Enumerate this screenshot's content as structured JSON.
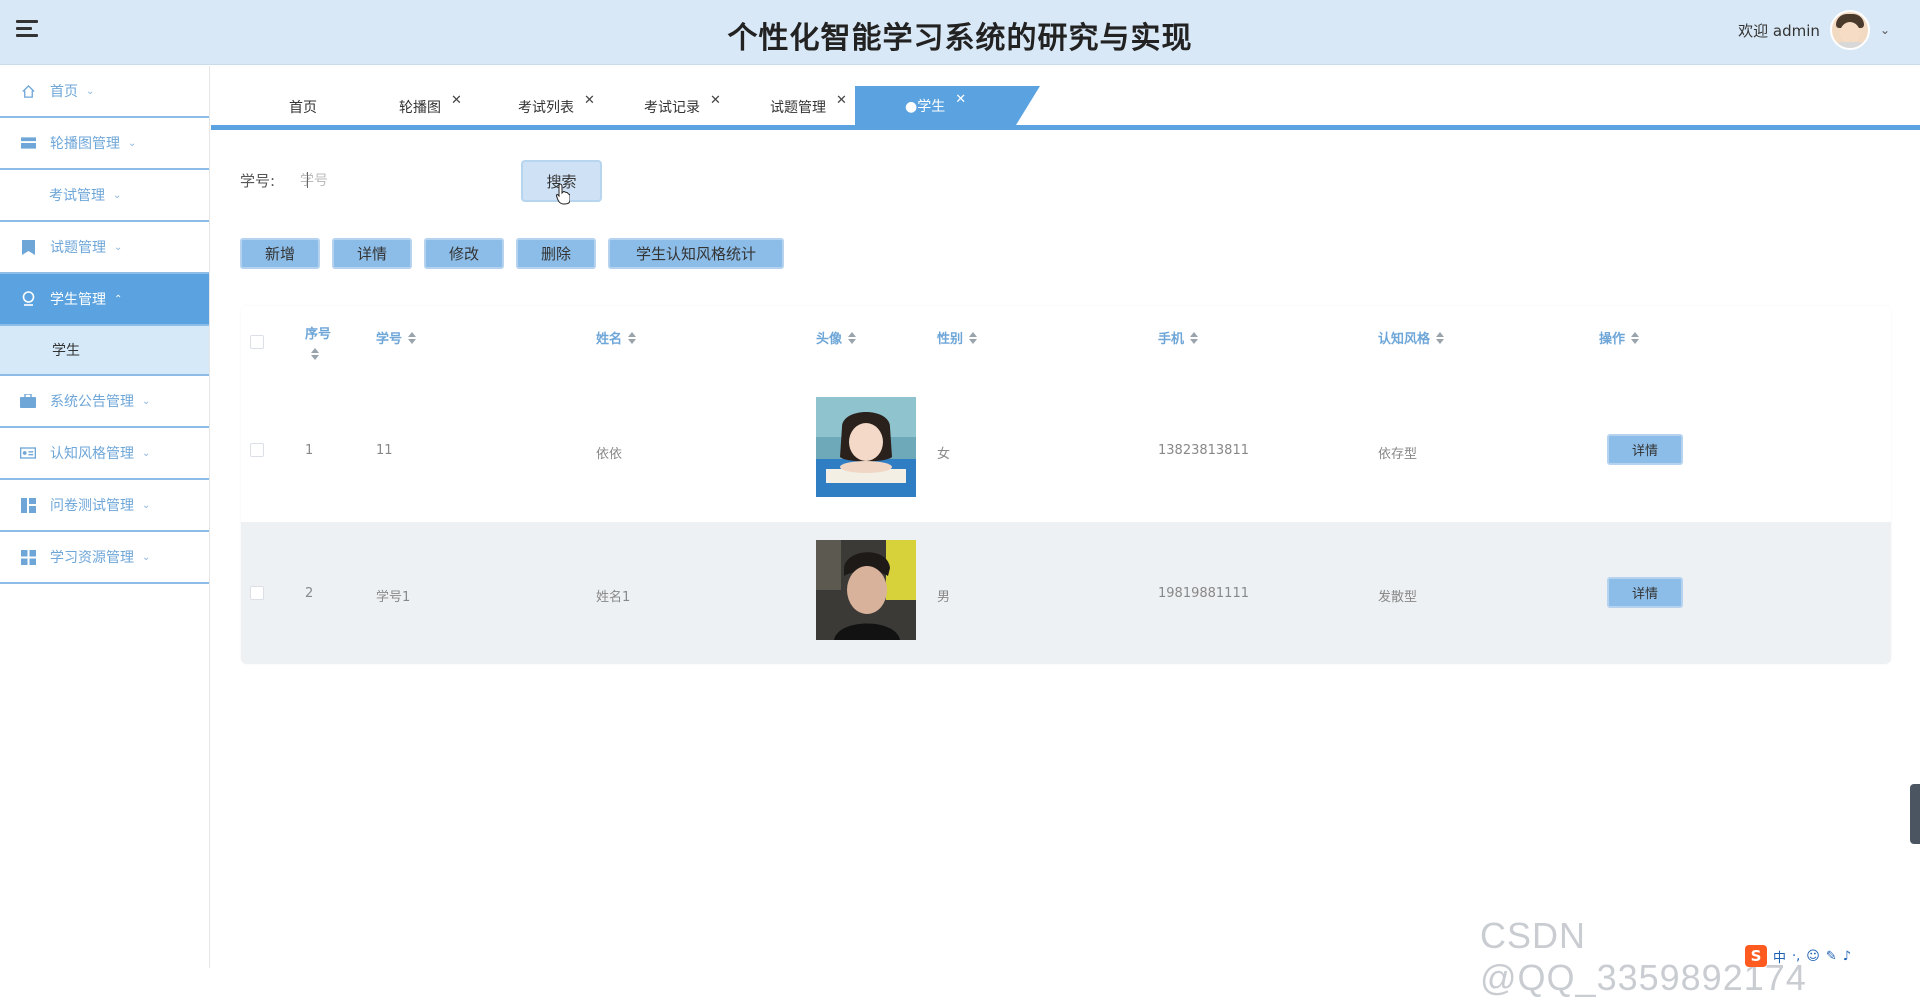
{
  "header": {
    "title": "个性化智能学习系统的研究与实现",
    "welcome": "欢迎 admin"
  },
  "sidebar": {
    "items": [
      {
        "label": "首页",
        "icon": "home-icon"
      },
      {
        "label": "轮播图管理",
        "icon": "carousel-icon"
      },
      {
        "label": "考试管理",
        "icon": "none"
      },
      {
        "label": "试题管理",
        "icon": "bookmark-icon"
      },
      {
        "label": "学生管理",
        "icon": "user-icon"
      },
      {
        "label": "系统公告管理",
        "icon": "briefcase-icon"
      },
      {
        "label": "认知风格管理",
        "icon": "id-card-icon"
      },
      {
        "label": "问卷测试管理",
        "icon": "dashboard-icon"
      },
      {
        "label": "学习资源管理",
        "icon": "grid-icon"
      }
    ],
    "sub_item": "学生"
  },
  "tabs": [
    {
      "label": "首页"
    },
    {
      "label": "轮播图"
    },
    {
      "label": "考试列表"
    },
    {
      "label": "考试记录"
    },
    {
      "label": "试题管理"
    },
    {
      "label": "●学生"
    }
  ],
  "search": {
    "label": "学号:",
    "placeholder": "学号",
    "button": "搜索"
  },
  "actions": [
    "新增",
    "详情",
    "修改",
    "删除",
    "学生认知风格统计"
  ],
  "table": {
    "headers": [
      "序号",
      "学号",
      "姓名",
      "头像",
      "性别",
      "手机",
      "认知风格",
      "操作"
    ],
    "rows": [
      {
        "index": "1",
        "student_no": "11",
        "name": "依依",
        "gender": "女",
        "phone": "13823813811",
        "style": "依存型",
        "action": "详情"
      },
      {
        "index": "2",
        "student_no": "学号1",
        "name": "姓名1",
        "gender": "男",
        "phone": "19819881111",
        "style": "发散型",
        "action": "详情"
      }
    ]
  },
  "watermark": "CSDN @QQ_3359892174",
  "ime": {
    "lang": "中",
    "logo": "S"
  },
  "colors": {
    "accent": "#5aa3e0",
    "header_bg": "#d9e8f6",
    "button": "#8cbde8"
  }
}
